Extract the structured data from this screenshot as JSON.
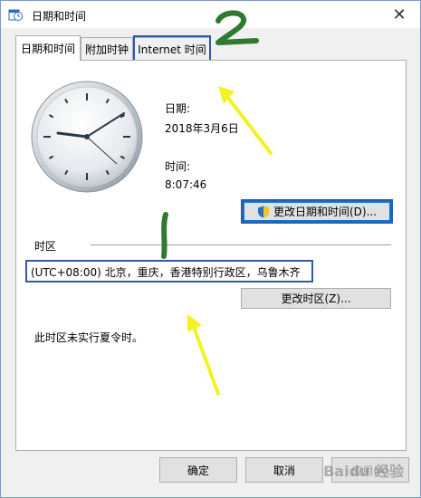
{
  "window": {
    "title": "日期和时间",
    "close_glyph": "✕"
  },
  "tabs": [
    {
      "label": "日期和时间"
    },
    {
      "label": "附加时钟"
    },
    {
      "label": "Internet 时间"
    }
  ],
  "datetime": {
    "date_label": "日期:",
    "date_value": "2018年3月6日",
    "time_label": "时间:",
    "time_value": "8:07:46",
    "change_button": "更改日期和时间(D)..."
  },
  "timezone": {
    "section_label": "时区",
    "value": "(UTC+08:00) 北京，重庆，香港特别行政区，乌鲁木齐",
    "change_button": "更改时区(Z)...",
    "dst_note": "此时区未实行夏令时。"
  },
  "footer": {
    "ok": "确定",
    "cancel": "取消",
    "apply": "应用(A)"
  },
  "annotations": {
    "number_1": "1",
    "number_2": "2",
    "stroke_color_green": "#2f7a2f",
    "arrow_color_yellow": "#f2f227"
  },
  "watermark": "Baidu 经验"
}
